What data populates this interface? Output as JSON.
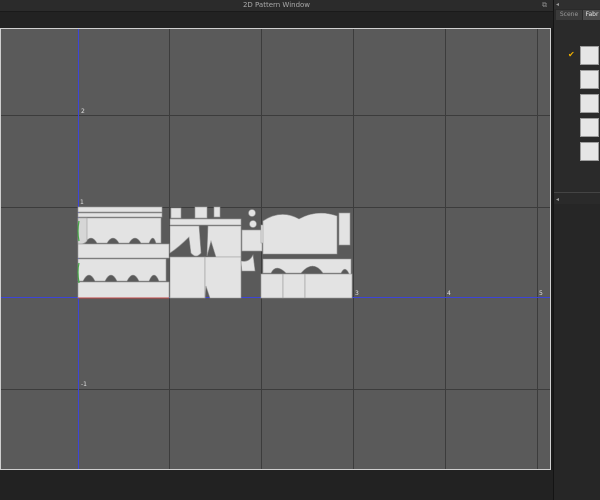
{
  "window": {
    "title": "2D Pattern Window",
    "float_icon": "float-window-icon"
  },
  "axis_labels": {
    "y_plus_2": "2",
    "y_plus_1": "1",
    "y_minus_1": "-1",
    "y_minus_2": "-2",
    "x_3": "3",
    "x_4": "4",
    "x_5": "5"
  },
  "panel": {
    "tabs": [
      {
        "label": "Scene"
      },
      {
        "label": "Fabr"
      }
    ],
    "fabric_count": 5,
    "selected_fabric": 1,
    "icons": [
      "collapse-arrow-icon",
      "checkmark-icon",
      "collapse-arrow-icon"
    ]
  },
  "colors": {
    "canvas_bg": "#5a5a5a",
    "grid": "#3c3c3c",
    "axis": "#3d45d8",
    "pattern_fill": "#e3e3e3",
    "selected_check": "#f0b000"
  }
}
